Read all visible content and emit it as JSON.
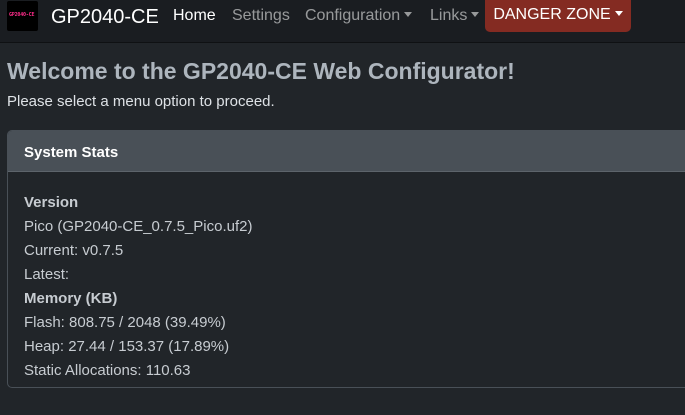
{
  "navbar": {
    "logo_text": "GP2040-CE",
    "brand": "GP2040-CE",
    "items": [
      {
        "label": "Home",
        "active": true,
        "dropdown": false
      },
      {
        "label": "Settings",
        "active": false,
        "dropdown": false
      },
      {
        "label": "Configuration",
        "active": false,
        "dropdown": true
      },
      {
        "label": "Links",
        "active": false,
        "dropdown": true
      }
    ],
    "danger_zone": "DANGER ZONE"
  },
  "page": {
    "title": "Welcome to the GP2040-CE Web Configurator!",
    "subtitle": "Please select a menu option to proceed."
  },
  "stats_card": {
    "header": "System Stats",
    "version_heading": "Version",
    "version_value": "Pico (GP2040-CE_0.7.5_Pico.uf2)",
    "current": "Current: v0.7.5",
    "latest": "Latest:",
    "memory_heading": "Memory (KB)",
    "flash": "Flash: 808.75 / 2048 (39.49%)",
    "heap": "Heap: 27.44 / 153.37 (17.89%)",
    "static_alloc": "Static Allocations: 110.63"
  },
  "colors": {
    "navbar_bg": "#1a1d21",
    "page_bg": "#212529",
    "danger": "#842b22",
    "card_header_bg": "#495057"
  }
}
